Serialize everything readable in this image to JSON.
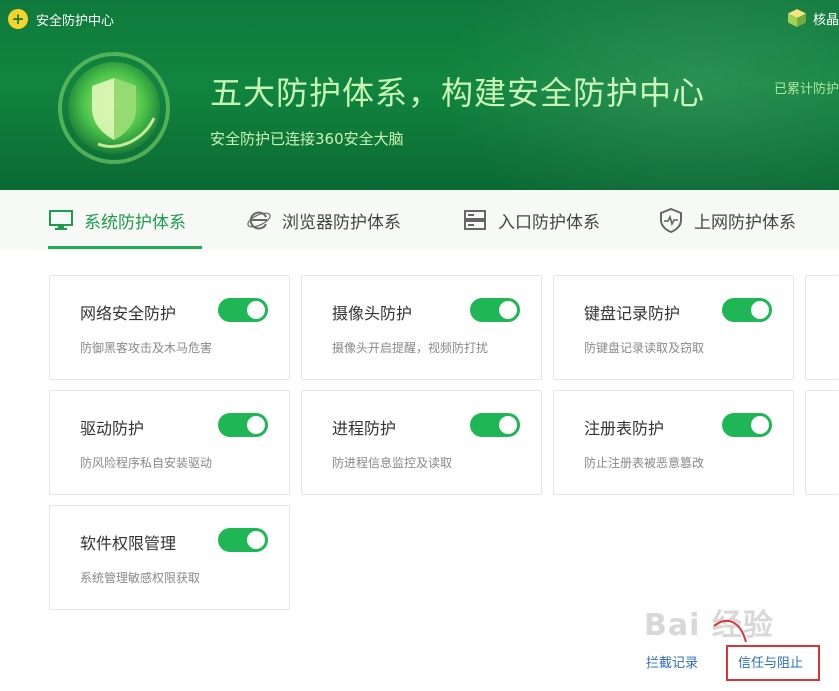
{
  "window": {
    "title": "安全防护中心",
    "right_label": "核晶"
  },
  "banner": {
    "headline": "五大防护体系，构建安全防护中心",
    "subline": "安全防护已连接360安全大脑",
    "stats_text": "已累计防护"
  },
  "tabs": [
    {
      "label": "系统防护体系",
      "icon": "monitor-icon",
      "active": true
    },
    {
      "label": "浏览器防护体系",
      "icon": "browser-e-icon",
      "active": false
    },
    {
      "label": "入口防护体系",
      "icon": "server-icon",
      "active": false
    },
    {
      "label": "上网防护体系",
      "icon": "shield-pulse-icon",
      "active": false
    }
  ],
  "cards": [
    {
      "title": "网络安全防护",
      "desc": "防御黑客攻击及木马危害",
      "enabled": true
    },
    {
      "title": "摄像头防护",
      "desc": "摄像头开启提醒，视频防打扰",
      "enabled": true
    },
    {
      "title": "键盘记录防护",
      "desc": "防键盘记录读取及窃取",
      "enabled": true
    },
    {
      "title": "驱动防护",
      "desc": "防风险程序私自安装驱动",
      "enabled": true
    },
    {
      "title": "进程防护",
      "desc": "防进程信息监控及读取",
      "enabled": true
    },
    {
      "title": "注册表防护",
      "desc": "防止注册表被恶意篡改",
      "enabled": true
    },
    {
      "title": "软件权限管理",
      "desc": "系统管理敏感权限获取",
      "enabled": true
    }
  ],
  "footer": {
    "log_link": "拦截记录",
    "trust_link": "信任与阻止"
  },
  "watermark": "Bai 经验",
  "colors": {
    "brand_green": "#11853f",
    "accent_green": "#1fb656",
    "highlight_red": "#d83636"
  }
}
